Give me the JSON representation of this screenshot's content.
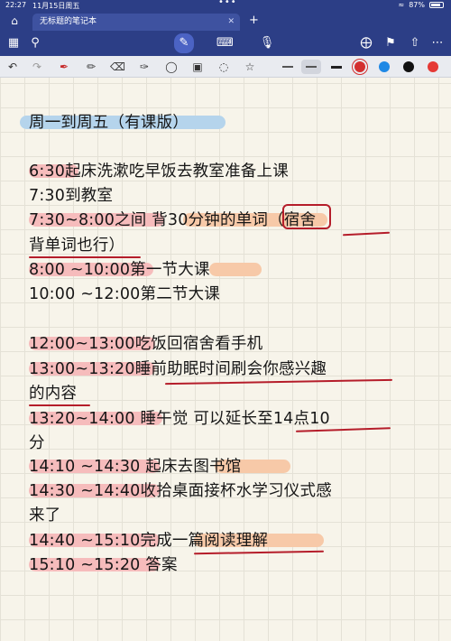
{
  "status": {
    "time": "22:27",
    "date": "11月15日周五",
    "battery": "87%",
    "battery_level": 0.87
  },
  "tab": {
    "title": "无标题的笔记本"
  },
  "icons": {
    "home": "home-icon",
    "sidebar": "sidebar-icon",
    "search": "search-icon",
    "pen_mode": "pen-icon",
    "keyboard": "keyboard-icon",
    "mic": "microphone-icon",
    "add_page": "add-page-icon",
    "bookmark": "bookmark-icon",
    "share": "share-icon",
    "more": "more-icon",
    "undo": "undo-icon",
    "redo": "redo-icon",
    "pen": "pen-tool-icon",
    "pencil": "pencil-icon",
    "eraser": "eraser-icon",
    "highlighter": "highlighter-icon",
    "shapes": "shapes-icon",
    "select": "lasso-icon",
    "image": "image-icon",
    "text": "text-tool-icon",
    "star": "star-icon"
  },
  "colors": {
    "toolbar_bg": "#2c3e86",
    "swatches": [
      "#d32f2f",
      "#1e88e5",
      "#111111",
      "#e53935"
    ]
  },
  "note": {
    "lines": [
      "周一到周五（有课版）",
      "6:30起床洗漱吃早饭去教室准备上课",
      "7:30到教室",
      "7:30~8:00之间 背30分钟的单词（宿舍",
      "背单词也行）",
      "8:00 ~10:00第一节大课",
      "10:00 ~12:00第二节大课",
      "12:00~13:00吃饭回宿舍看手机",
      "13:00~13:20睡前助眠时间刷会你感兴趣",
      "的内容",
      "13:20~14:00 睡午觉 可以延长至14点10",
      "分",
      "14:10 ~14:30 起床去图书馆",
      "14:30 ~14:40收拾桌面接杯水学习仪式感",
      "来了",
      "14:40 ~15:10完成一篇阅读理解",
      "15:10 ~15:20 答案"
    ]
  }
}
